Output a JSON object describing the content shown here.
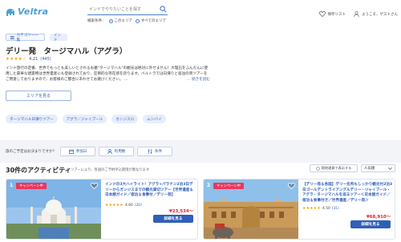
{
  "header": {
    "logo_text": "Veltra",
    "search_placeholder": "インドでやりたいことを探す",
    "scope_label": "検索条件：",
    "scope_options": [
      "このエリア",
      "すべてのエリア"
    ],
    "saved_label": "保存リスト",
    "greeting": "ようこそ、ゲストさん"
  },
  "breadcrumb": {
    "category_label": "カテゴリー一覧",
    "area_label": "インド"
  },
  "page": {
    "title": "デリー発　タージマハル（アグラ）",
    "stars": "★★★★☆",
    "rating": "4.21",
    "review_count": "(445)",
    "description": "インド旅行の定番、世界でもっとも美しいとされるお墓\"タージマハル\"の観光は絶対に外せません！大理石をふんだんに使用した豪華な建築物は世界遺産にも登録されており、圧倒的な存在感を誇ります。ベルトラでは日帰りと宿泊の両ツアーをご用意しておりますので、お客様のご都合にあわせてお選びください。 ...",
    "read_more": "... 続きを読む",
    "area_button": "エリアを見る"
  },
  "tags": [
    "タージマハル日帰りツアー",
    "アグラ／ジャイプール",
    "カンジス川",
    "ムンバイ"
  ],
  "filters": {
    "label": "旅のご予定はお決まりですか？",
    "buttons": [
      "参加日",
      "利用数",
      "条件"
    ]
  },
  "results": {
    "title": "30件のアクティビティ",
    "note": "※ ツアーにより、各国のご予約申込期限が異なります",
    "map_button": "現地通貨で表示する",
    "sort_label": "人気順"
  },
  "cards": [
    {
      "rank": "1",
      "badge": "キャンペーン中",
      "title": "インドの3大ハイライト！アグラ+パラナン2泊3日デリーからガンジスまでの観光貸切ツアー【世界遺産＆日本語ガイド／宿泊＆食事付／デリー発】",
      "stars": "★★★★★",
      "rating": "4.60",
      "review_count": "(20)",
      "price": "¥23,534～",
      "button": "詳細を見る"
    },
    {
      "rank": "2",
      "badge": "キャンペーン中",
      "title": "【デリー発＆各国】デリー名所もしっかり観光付2泊3日ゴールデントライアングルデリー・ジャイプール・アグラ・タージマハルを巡るツアー＜日本語ガイド／宿泊＆食事付き／世界遺産／デリー発＞",
      "stars": "★★★★★",
      "rating": "4.50",
      "review_count": "(31)",
      "price": "¥68,910～",
      "button": "詳細を見る"
    }
  ],
  "colors": {
    "accent": "#2f5fb8",
    "badge": "#e8385e",
    "price": "#e02020",
    "star": "#f2a300"
  }
}
